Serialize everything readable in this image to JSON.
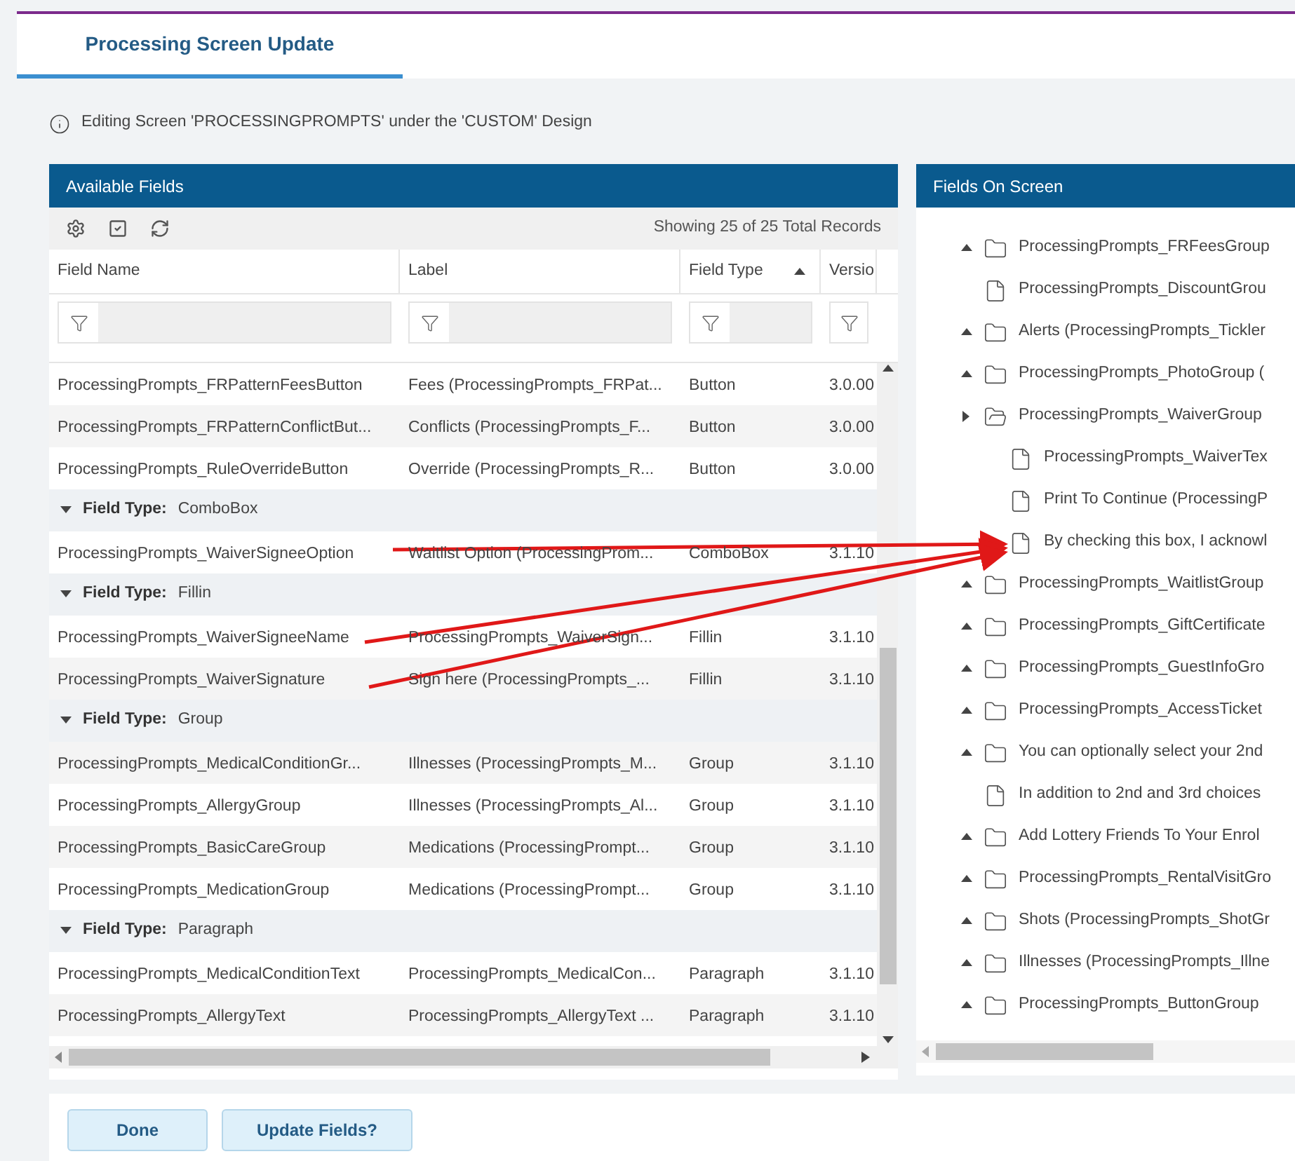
{
  "tab": {
    "label": "Processing Screen Update",
    "selected": true
  },
  "info": "Editing Screen 'PROCESSINGPROMPTS' under the 'CUSTOM' Design",
  "available_fields": {
    "title": "Available Fields",
    "record_count": "Showing 25 of 25 Total Records",
    "columns": [
      {
        "label": "Field Name",
        "sorted": false
      },
      {
        "label": "Label",
        "sorted": false
      },
      {
        "label": "Field Type",
        "sorted": true
      },
      {
        "label": "Versio",
        "sorted": false
      }
    ],
    "rows": [
      {
        "kind": "data",
        "cells": [
          "ProcessingPrompts_FRPatternFeesButton",
          "Fees (ProcessingPrompts_FRPat...",
          "Button",
          "3.0.00"
        ]
      },
      {
        "kind": "data",
        "cells": [
          "ProcessingPrompts_FRPatternConflictBut...",
          "Conflicts (ProcessingPrompts_F...",
          "Button",
          "3.0.00"
        ]
      },
      {
        "kind": "data",
        "cells": [
          "ProcessingPrompts_RuleOverrideButton",
          "Override (ProcessingPrompts_R...",
          "Button",
          "3.0.00"
        ]
      },
      {
        "kind": "group",
        "label": "Field Type:",
        "value": "ComboBox",
        "expanded": true
      },
      {
        "kind": "data",
        "cells": [
          "ProcessingPrompts_WaiverSigneeOption",
          "Waitlist Option (ProcessingProm...",
          "ComboBox",
          "3.1.10"
        ]
      },
      {
        "kind": "group",
        "label": "Field Type:",
        "value": "Fillin",
        "expanded": true
      },
      {
        "kind": "data",
        "cells": [
          "ProcessingPrompts_WaiverSigneeName",
          "ProcessingPrompts_WaiverSign...",
          "Fillin",
          "3.1.10"
        ]
      },
      {
        "kind": "data",
        "cells": [
          "ProcessingPrompts_WaiverSignature",
          "Sign here (ProcessingPrompts_...",
          "Fillin",
          "3.1.10"
        ]
      },
      {
        "kind": "group",
        "label": "Field Type:",
        "value": "Group",
        "expanded": true
      },
      {
        "kind": "data",
        "cells": [
          "ProcessingPrompts_MedicalConditionGr...",
          "Illnesses (ProcessingPrompts_M...",
          "Group",
          "3.1.10"
        ]
      },
      {
        "kind": "data",
        "cells": [
          "ProcessingPrompts_AllergyGroup",
          "Illnesses (ProcessingPrompts_Al...",
          "Group",
          "3.1.10"
        ]
      },
      {
        "kind": "data",
        "cells": [
          "ProcessingPrompts_BasicCareGroup",
          "Medications (ProcessingPrompt...",
          "Group",
          "3.1.10"
        ]
      },
      {
        "kind": "data",
        "cells": [
          "ProcessingPrompts_MedicationGroup",
          "Medications (ProcessingPrompt...",
          "Group",
          "3.1.10"
        ]
      },
      {
        "kind": "group",
        "label": "Field Type:",
        "value": "Paragraph",
        "expanded": true
      },
      {
        "kind": "data",
        "cells": [
          "ProcessingPrompts_MedicalConditionText",
          "ProcessingPrompts_MedicalCon...",
          "Paragraph",
          "3.1.10"
        ]
      },
      {
        "kind": "data",
        "cells": [
          "ProcessingPrompts_AllergyText",
          "ProcessingPrompts_AllergyText ...",
          "Paragraph",
          "3.1.10"
        ]
      }
    ]
  },
  "fields_on_screen": {
    "title": "Fields On Screen",
    "items": [
      {
        "kind": "folder",
        "label": "ProcessingPrompts_FRFeesGroup",
        "expanded": false
      },
      {
        "kind": "file",
        "label": "ProcessingPrompts_DiscountGrou"
      },
      {
        "kind": "folder",
        "label": "Alerts (ProcessingPrompts_Tickler",
        "expanded": false
      },
      {
        "kind": "folder",
        "label": "ProcessingPrompts_PhotoGroup (",
        "expanded": false
      },
      {
        "kind": "folder",
        "label": "ProcessingPrompts_WaiverGroup",
        "expanded": true,
        "children": [
          {
            "kind": "file",
            "label": "ProcessingPrompts_WaiverTex"
          },
          {
            "kind": "file",
            "label": "Print To Continue (ProcessingP"
          },
          {
            "kind": "file",
            "label": "By checking this box, I acknowl"
          }
        ]
      },
      {
        "kind": "folder",
        "label": "ProcessingPrompts_WaitlistGroup",
        "expanded": false
      },
      {
        "kind": "folder",
        "label": "ProcessingPrompts_GiftCertificate",
        "expanded": false
      },
      {
        "kind": "folder",
        "label": "ProcessingPrompts_GuestInfoGro",
        "expanded": false
      },
      {
        "kind": "folder",
        "label": "ProcessingPrompts_AccessTicket",
        "expanded": false
      },
      {
        "kind": "folder",
        "label": "You can optionally select your 2nd",
        "expanded": false
      },
      {
        "kind": "file",
        "label": "In addition to 2nd and 3rd choices"
      },
      {
        "kind": "folder",
        "label": "Add Lottery Friends To Your Enrol",
        "expanded": false
      },
      {
        "kind": "folder",
        "label": "ProcessingPrompts_RentalVisitGro",
        "expanded": false
      },
      {
        "kind": "folder",
        "label": "Shots (ProcessingPrompts_ShotGr",
        "expanded": false
      },
      {
        "kind": "folder",
        "label": "Illnesses (ProcessingPrompts_Illne",
        "expanded": false
      },
      {
        "kind": "folder",
        "label": "ProcessingPrompts_ButtonGroup",
        "expanded": false
      }
    ]
  },
  "buttons": [
    "Done",
    "Update Fields?"
  ]
}
